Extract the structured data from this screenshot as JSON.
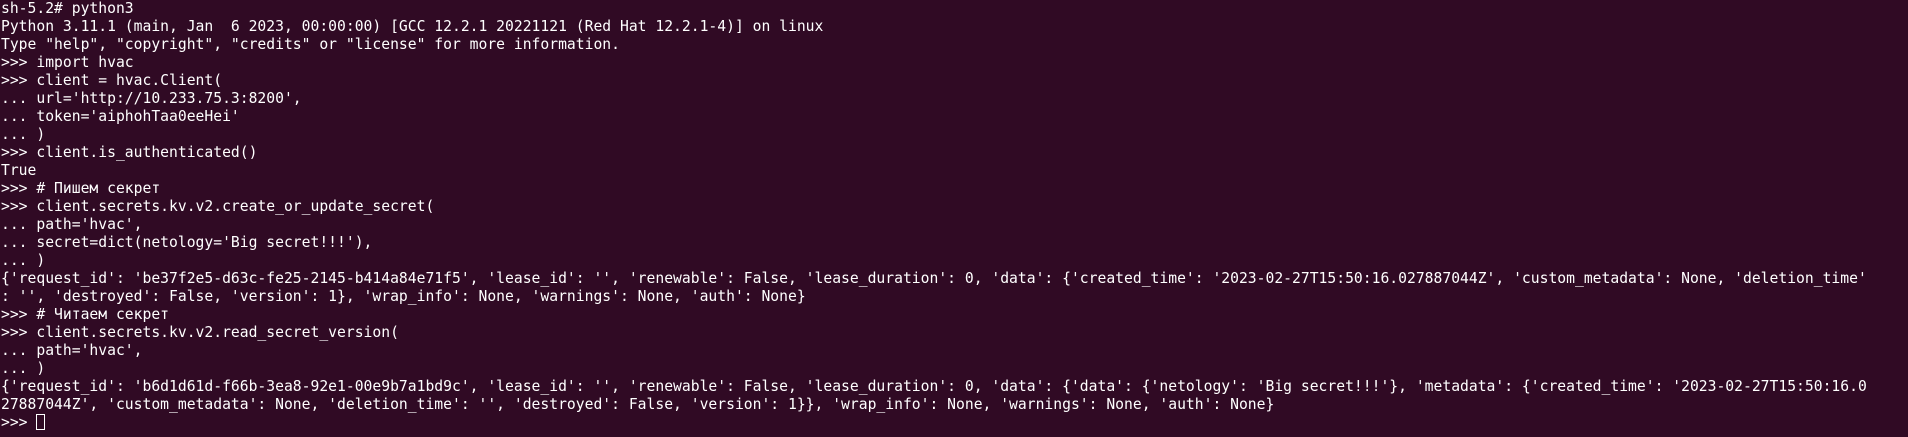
{
  "terminal": {
    "lines": [
      "sh-5.2# python3",
      "Python 3.11.1 (main, Jan  6 2023, 00:00:00) [GCC 12.2.1 20221121 (Red Hat 12.2.1-4)] on linux",
      "Type \"help\", \"copyright\", \"credits\" or \"license\" for more information.",
      ">>> import hvac",
      ">>> client = hvac.Client(",
      "... url='http://10.233.75.3:8200',",
      "... token='aiphohTaa0eeHei'",
      "... )",
      ">>> client.is_authenticated()",
      "True",
      ">>> # Пишем секрет",
      ">>> client.secrets.kv.v2.create_or_update_secret(",
      "... path='hvac',",
      "... secret=dict(netology='Big secret!!!'),",
      "... )",
      "{'request_id': 'be37f2e5-d63c-fe25-2145-b414a84e71f5', 'lease_id': '', 'renewable': False, 'lease_duration': 0, 'data': {'created_time': '2023-02-27T15:50:16.027887044Z', 'custom_metadata': None, 'deletion_time'",
      ": '', 'destroyed': False, 'version': 1}, 'wrap_info': None, 'warnings': None, 'auth': None}",
      ">>> # Читаем секрет",
      ">>> client.secrets.kv.v2.read_secret_version(",
      "... path='hvac',",
      "... )",
      "{'request_id': 'b6d1d61d-f66b-3ea8-92e1-00e9b7a1bd9c', 'lease_id': '', 'renewable': False, 'lease_duration': 0, 'data': {'data': {'netology': 'Big secret!!!'}, 'metadata': {'created_time': '2023-02-27T15:50:16.0",
      "27887044Z', 'custom_metadata': None, 'deletion_time': '', 'destroyed': False, 'version': 1}}, 'wrap_info': None, 'warnings': None, 'auth': None}"
    ],
    "prompt": ">>> "
  },
  "colors": {
    "background": "#300a24",
    "foreground": "#ffffff"
  }
}
